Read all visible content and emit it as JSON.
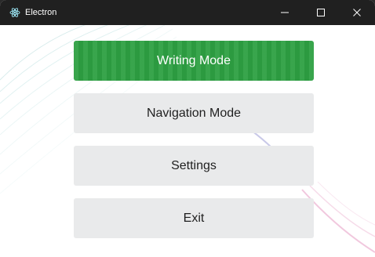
{
  "window": {
    "title": "Electron",
    "app_icon": "electron-atom-icon",
    "controls": {
      "minimize_icon": "minimize-icon",
      "maximize_icon": "maximize-icon",
      "close_icon": "close-icon"
    }
  },
  "menu": {
    "writing_mode": "Writing Mode",
    "navigation_mode": "Navigation Mode",
    "settings": "Settings",
    "exit": "Exit"
  },
  "colors": {
    "primary_button": "#2ea043",
    "secondary_button": "#e9eaeb",
    "titlebar": "#202020"
  }
}
